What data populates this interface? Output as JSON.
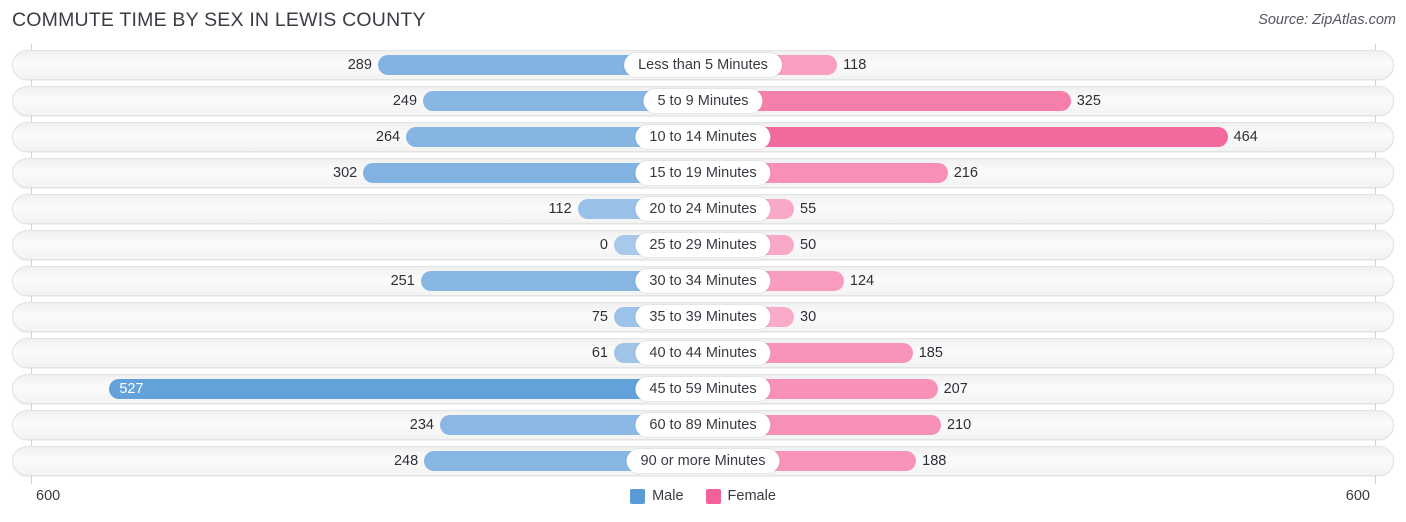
{
  "header": {
    "title": "COMMUTE TIME BY SEX IN LEWIS COUNTY",
    "source": "Source: ZipAtlas.com"
  },
  "axis": {
    "left_label": "600",
    "right_label": "600",
    "max": 600
  },
  "legend": {
    "items": [
      {
        "label": "Male",
        "color": "#5b9bd5"
      },
      {
        "label": "Female",
        "color": "#f2609e"
      }
    ]
  },
  "chart_data": {
    "type": "bar",
    "title": "COMMUTE TIME BY SEX IN LEWIS COUNTY",
    "subtitle": "Source: ZipAtlas.com",
    "orientation": "horizontal-diverging",
    "xlabel": "",
    "ylabel": "",
    "xlim": [
      600,
      600
    ],
    "grid": false,
    "legend_position": "bottom-center",
    "categories": [
      "Less than 5 Minutes",
      "5 to 9 Minutes",
      "10 to 14 Minutes",
      "15 to 19 Minutes",
      "20 to 24 Minutes",
      "25 to 29 Minutes",
      "30 to 34 Minutes",
      "35 to 39 Minutes",
      "40 to 44 Minutes",
      "45 to 59 Minutes",
      "60 to 89 Minutes",
      "90 or more Minutes"
    ],
    "series": [
      {
        "name": "Male",
        "color": "#5b9bd5",
        "values": [
          289,
          249,
          264,
          302,
          112,
          0,
          251,
          75,
          61,
          527,
          234,
          248
        ]
      },
      {
        "name": "Female",
        "color": "#f2609e",
        "values": [
          118,
          325,
          464,
          216,
          55,
          50,
          124,
          30,
          185,
          207,
          210,
          188
        ]
      }
    ]
  },
  "rows": [
    {
      "label": "Less than 5 Minutes",
      "male": "289",
      "female": "118",
      "male_value": 289,
      "female_value": 118
    },
    {
      "label": "5 to 9 Minutes",
      "male": "249",
      "female": "325",
      "male_value": 249,
      "female_value": 325
    },
    {
      "label": "10 to 14 Minutes",
      "male": "264",
      "female": "464",
      "male_value": 264,
      "female_value": 464
    },
    {
      "label": "15 to 19 Minutes",
      "male": "302",
      "female": "216",
      "male_value": 302,
      "female_value": 216
    },
    {
      "label": "20 to 24 Minutes",
      "male": "112",
      "female": "55",
      "male_value": 112,
      "female_value": 55
    },
    {
      "label": "25 to 29 Minutes",
      "male": "0",
      "female": "50",
      "male_value": 0,
      "female_value": 50
    },
    {
      "label": "30 to 34 Minutes",
      "male": "251",
      "female": "124",
      "male_value": 251,
      "female_value": 124
    },
    {
      "label": "35 to 39 Minutes",
      "male": "75",
      "female": "30",
      "male_value": 75,
      "female_value": 30
    },
    {
      "label": "40 to 44 Minutes",
      "male": "61",
      "female": "185",
      "male_value": 61,
      "female_value": 185
    },
    {
      "label": "45 to 59 Minutes",
      "male": "527",
      "female": "207",
      "male_value": 527,
      "female_value": 207
    },
    {
      "label": "60 to 89 Minutes",
      "male": "234",
      "female": "210",
      "male_value": 234,
      "female_value": 210
    },
    {
      "label": "90 or more Minutes",
      "male": "248",
      "female": "188",
      "male_value": 248,
      "female_value": 188
    }
  ]
}
